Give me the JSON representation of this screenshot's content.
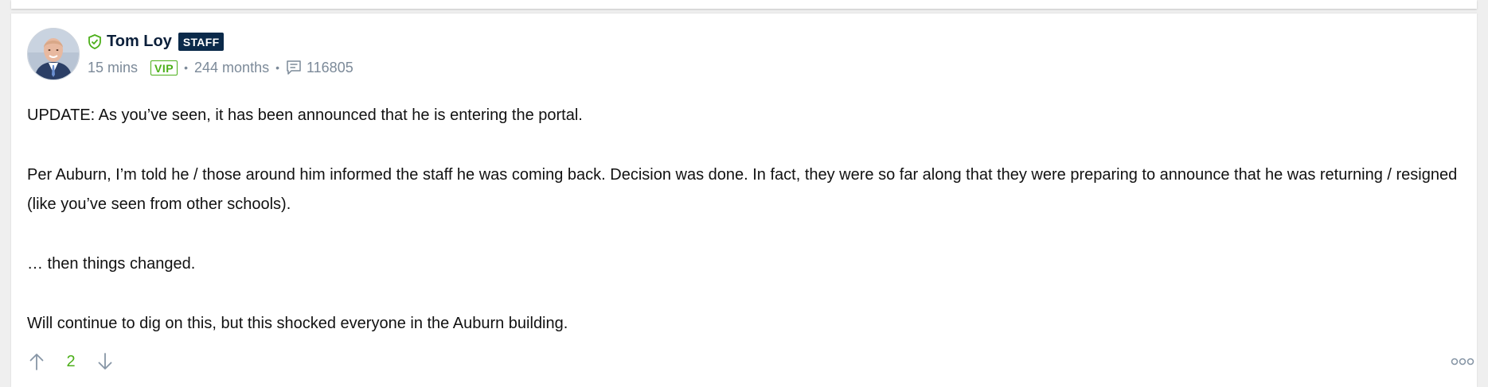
{
  "post": {
    "author": {
      "name": "Tom Loy",
      "role_badge": "STAFF",
      "verified_icon": "shield-check-icon",
      "avatar_icon": "user-avatar"
    },
    "meta": {
      "posted_ago": "15 mins",
      "membership_badge": "VIP",
      "member_tenure": "244 months",
      "post_count_icon": "message-icon",
      "post_count": "116805"
    },
    "body": {
      "paragraphs": [
        "UPDATE: As you’ve seen, it has been announced that he is entering the portal.",
        "Per Auburn, I’m told he / those around him informed the staff he was coming back. Decision was done. In fact, they were so far along that they were preparing to announce that he was returning / resigned (like you’ve seen from other schools).",
        "… then things changed.",
        "Will continue to dig on this, but this shocked everyone in the Auburn building."
      ]
    },
    "votes": {
      "upvote_icon": "arrow-up-icon",
      "count": "2",
      "downvote_icon": "arrow-down-icon",
      "more_icon": "more-options-icon"
    }
  },
  "colors": {
    "accent_green": "#4caf1a",
    "staff_badge_bg": "#0b2a4a",
    "meta_text": "#7c8a99"
  }
}
